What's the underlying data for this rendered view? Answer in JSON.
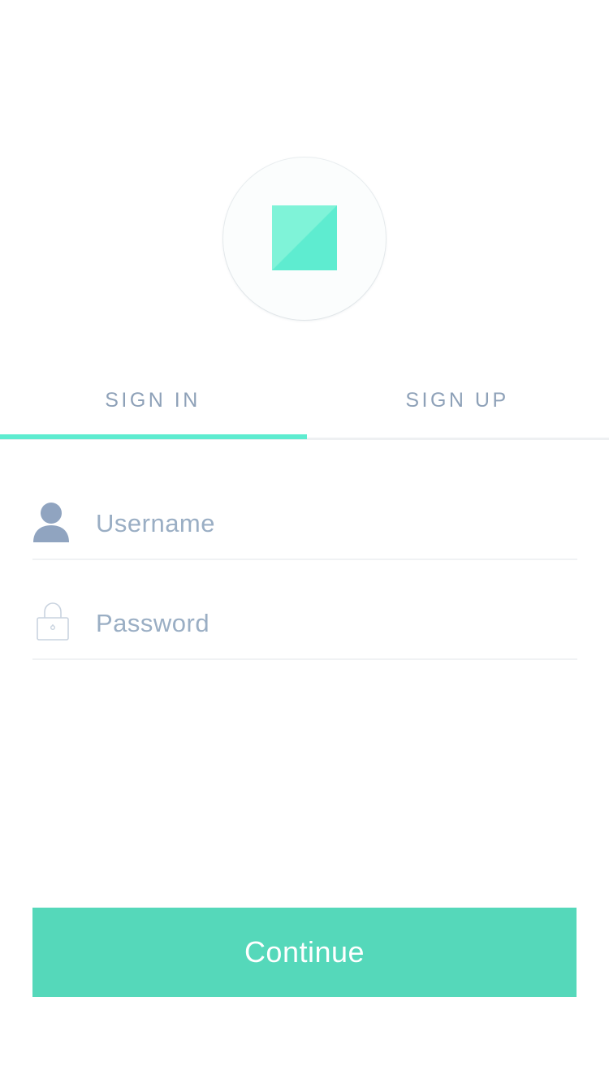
{
  "logo": {
    "icon": "square-logo-icon",
    "accent_light": "#7ff3d8",
    "accent": "#5eecd0"
  },
  "tabs": [
    {
      "label": "SIGN IN",
      "active": true
    },
    {
      "label": "SIGN UP",
      "active": false
    }
  ],
  "form": {
    "username": {
      "placeholder": "Username",
      "value": "",
      "icon": "user-icon"
    },
    "password": {
      "placeholder": "Password",
      "value": "",
      "icon": "lock-icon"
    }
  },
  "continue_button": {
    "label": "Continue",
    "color": "#55d8ba"
  },
  "colors": {
    "text_muted": "#8ea1b8",
    "placeholder": "#9aaec4",
    "divider": "#f0f2f4"
  }
}
